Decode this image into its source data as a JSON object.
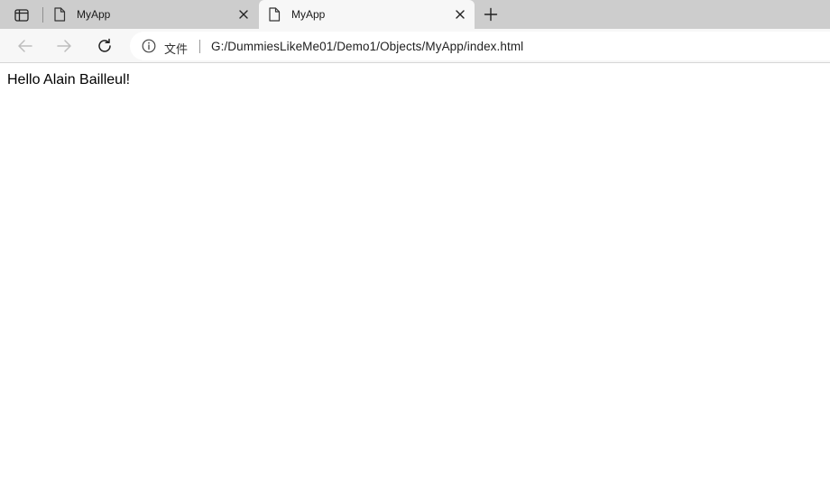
{
  "tabs": [
    {
      "title": "MyApp",
      "active": false
    },
    {
      "title": "MyApp",
      "active": true
    }
  ],
  "icons": {
    "tab_actions": "tab-actions-icon",
    "page": "page-icon",
    "close": "close-icon",
    "new_tab": "plus-icon",
    "back": "back-arrow-icon",
    "forward": "forward-arrow-icon",
    "refresh": "refresh-icon",
    "info": "info-icon"
  },
  "address_bar": {
    "scheme_label": "文件",
    "url": "G:/DummiesLikeMe01/Demo1/Objects/MyApp/index.html"
  },
  "page": {
    "greeting": "Hello Alain Bailleul!"
  }
}
